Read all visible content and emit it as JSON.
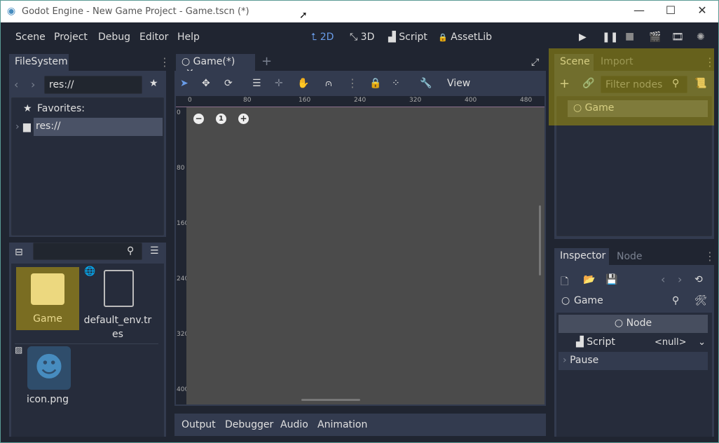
{
  "window": {
    "title": "Godot Engine - New Game Project - Game.tscn (*)",
    "minimize": "—",
    "maximize": "☐",
    "close": "✕"
  },
  "menu": [
    "Scene",
    "Project",
    "Debug",
    "Editor",
    "Help"
  ],
  "workspaces": [
    {
      "label": "2D",
      "icon": "⮤"
    },
    {
      "label": "3D",
      "icon": "⤡"
    },
    {
      "label": "Script",
      "icon": "▟"
    },
    {
      "label": "AssetLib",
      "icon": "🔒"
    }
  ],
  "filesystem": {
    "tab": "FileSystem",
    "path": "res://",
    "favorites": "Favorites:",
    "root": "res://",
    "files": [
      {
        "name": "Game"
      },
      {
        "name": "default_env.tres"
      },
      {
        "name": "icon.png"
      }
    ]
  },
  "editor": {
    "tab": "Game(*)",
    "view": "View",
    "ruler_x": [
      "0",
      "80",
      "160",
      "240",
      "320",
      "400",
      "480"
    ],
    "ruler_y": [
      "0",
      "80",
      "160",
      "240",
      "320",
      "400"
    ],
    "zoom_reset": "1"
  },
  "bottom_tabs": [
    "Output",
    "Debugger",
    "Audio",
    "Animation"
  ],
  "scene": {
    "tabs": [
      "Scene",
      "Import"
    ],
    "filter_placeholder": "Filter nodes",
    "root": "Game"
  },
  "inspector": {
    "tabs": [
      "Inspector",
      "Node"
    ],
    "object": "Game",
    "section": "Node",
    "script_label": "Script",
    "script_value": "<null>",
    "pause": "Pause"
  },
  "colors": {
    "accent": "#699ce8",
    "highlight": "#c8b400"
  }
}
